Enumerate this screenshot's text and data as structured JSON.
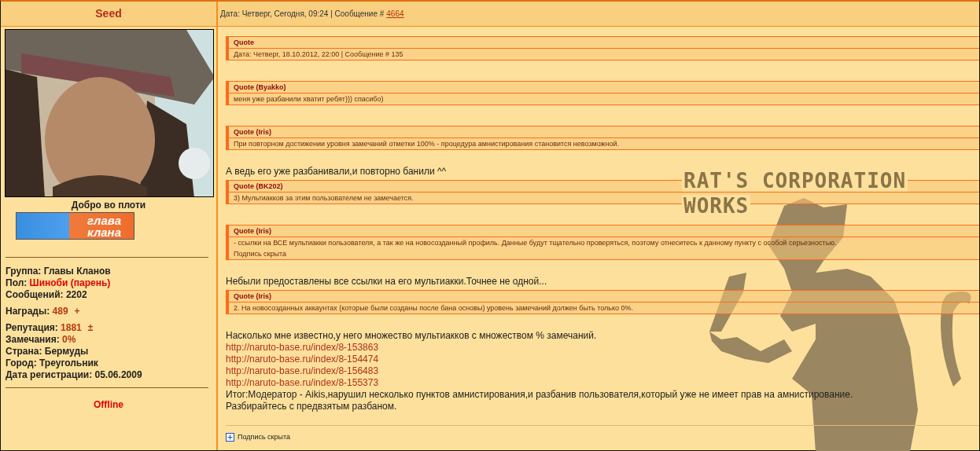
{
  "author": {
    "name": "Seed",
    "title": "Добро во плоти",
    "rank_badge": [
      "глава",
      "клана"
    ],
    "stats": [
      {
        "label": "Группа:",
        "value": "Главы Кланов",
        "kind": "plain"
      },
      {
        "label": "Пол:",
        "value": "Шиноби (парень)",
        "kind": "gender"
      },
      {
        "label": "Сообщений:",
        "value": "2202",
        "kind": "plain"
      },
      {
        "label": "Награды:",
        "value": "489",
        "action": "+",
        "kind": "counter"
      },
      {
        "label": "Репутация:",
        "value": "1881",
        "action": "±",
        "kind": "counter"
      },
      {
        "label": "Замечания:",
        "value": "0%",
        "kind": "warning"
      },
      {
        "label": "Страна:",
        "value": "Бермуды",
        "kind": "plain"
      },
      {
        "label": "Город:",
        "value": "Треугольник",
        "kind": "plain"
      },
      {
        "label": "Дата регистрации:",
        "value": "05.06.2009",
        "kind": "plain"
      }
    ],
    "status": "Offline"
  },
  "post": {
    "header": "Дата: Четверг, Сегодня, 09:24 | Сообщение #",
    "number": "4664",
    "blocks": [
      {
        "kind": "quote",
        "title": "Quote",
        "lines": [
          "Дата: Четверг, 18.10.2012, 22:00 | Сообщение # 135"
        ]
      },
      {
        "kind": "quote",
        "title": "Quote (Byakko)",
        "lines": [
          "меня уже разбанили хватит ребят))) спасибо)"
        ]
      },
      {
        "kind": "quote",
        "title": "Quote (Iris)",
        "lines": [
          "При повторном достижении уровня замечаний отметки 100% - процедура амнистирования становится невозможной."
        ]
      },
      {
        "kind": "text",
        "text": "А ведь его уже разбанивали,и повторно банили ^^"
      },
      {
        "kind": "quote",
        "title": "Quote (BK202)",
        "lines": [
          "3) Мультиакков за этим пользователем не замечается."
        ]
      },
      {
        "kind": "quote",
        "title": "Quote (Iris)",
        "lines": [
          "- ссылки на ВСЕ мультиакки пользователя, а так же на новосозданный профиль. Данные будут тщательно проверяться, поэтому отнеситесь к данному пункту с особой серьезностью.",
          "Подпись скрыта"
        ]
      },
      {
        "kind": "text",
        "text": "Небыли предоставлены все ссылки на его мультиакки.Точнее не одной..."
      },
      {
        "kind": "quote",
        "title": "Quote (Iris)",
        "lines": [
          "2. На новосозданных аккаунтах (которые были созданы после бана основы) уровень замечаний должен быть только 0%."
        ]
      },
      {
        "kind": "text",
        "text": "Насколько мне известно,у него множество мультиакков с множеством % замечаний."
      },
      {
        "kind": "link",
        "text": "http://naruto-base.ru/index/8-153863"
      },
      {
        "kind": "link",
        "text": "http://naruto-base.ru/index/8-154474"
      },
      {
        "kind": "link",
        "text": "http://naruto-base.ru/index/8-156483"
      },
      {
        "kind": "link",
        "text": "http://naruto-base.ru/index/8-155373"
      },
      {
        "kind": "text",
        "text": "Итог:Модератор - Aikis,нарушил несколько пунктов амнистирования,и разбанив пользователя,который уже не имеет прав на амнистирование."
      },
      {
        "kind": "text",
        "text": "Разбирайтесь с предвзятым разбаном."
      }
    ],
    "signature_art": [
      "RAT'S CORPORATION",
      "WORKS"
    ],
    "signature_toggle": "Подпись скрыта"
  }
}
